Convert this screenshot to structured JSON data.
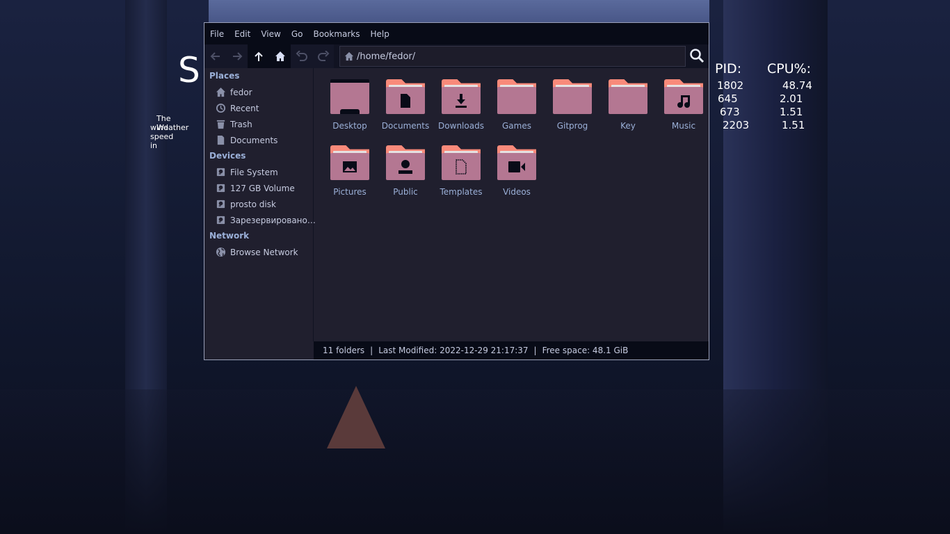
{
  "desktop": {
    "weather_widget": {
      "title_fragment": "S",
      "line1": "The Weather",
      "line2": "wind speed in"
    },
    "process_widget": {
      "headers": [
        "PID:",
        "CPU%:"
      ],
      "rows": [
        {
          "pid": "1802",
          "cpu": "48.74"
        },
        {
          "pid": "645",
          "cpu": "2.01"
        },
        {
          "pid": "673",
          "cpu": "1.51"
        },
        {
          "pid": "2203",
          "cpu": "1.51"
        }
      ]
    }
  },
  "window": {
    "menu": [
      "File",
      "Edit",
      "View",
      "Go",
      "Bookmarks",
      "Help"
    ],
    "toolbar": {
      "buttons": [
        "back",
        "forward",
        "up",
        "home",
        "undo",
        "redo"
      ],
      "path": "/home/fedor/",
      "search_icon": "search-icon"
    },
    "sidebar": {
      "sections": [
        {
          "title": "Places",
          "items": [
            {
              "label": "fedor",
              "icon": "home-icon"
            },
            {
              "label": "Recent",
              "icon": "clock-icon"
            },
            {
              "label": "Trash",
              "icon": "trash-icon"
            },
            {
              "label": "Documents",
              "icon": "document-icon"
            }
          ]
        },
        {
          "title": "Devices",
          "items": [
            {
              "label": "File System",
              "icon": "drive-icon"
            },
            {
              "label": "127 GB Volume",
              "icon": "drive-icon"
            },
            {
              "label": "prosto disk",
              "icon": "drive-icon"
            },
            {
              "label": "Зарезервировано…",
              "icon": "drive-icon"
            }
          ]
        },
        {
          "title": "Network",
          "items": [
            {
              "label": "Browse Network",
              "icon": "globe-icon"
            }
          ]
        }
      ]
    },
    "files": [
      {
        "name": "Desktop",
        "icon": "desktop"
      },
      {
        "name": "Documents",
        "icon": "document"
      },
      {
        "name": "Downloads",
        "icon": "download"
      },
      {
        "name": "Games",
        "icon": "none"
      },
      {
        "name": "Gitprog",
        "icon": "none"
      },
      {
        "name": "Key",
        "icon": "none"
      },
      {
        "name": "Music",
        "icon": "music"
      },
      {
        "name": "Pictures",
        "icon": "picture"
      },
      {
        "name": "Public",
        "icon": "person"
      },
      {
        "name": "Templates",
        "icon": "template"
      },
      {
        "name": "Videos",
        "icon": "video"
      }
    ],
    "status": {
      "count": "11 folders",
      "modified": "Last Modified: 2022-12-29 21:17:37",
      "free": "Free space: 48.1 GiB",
      "separator": "|"
    },
    "colors": {
      "folder_tab": "#f98a7a",
      "folder_body": "#b47792",
      "label": "#9bb0d8"
    }
  }
}
